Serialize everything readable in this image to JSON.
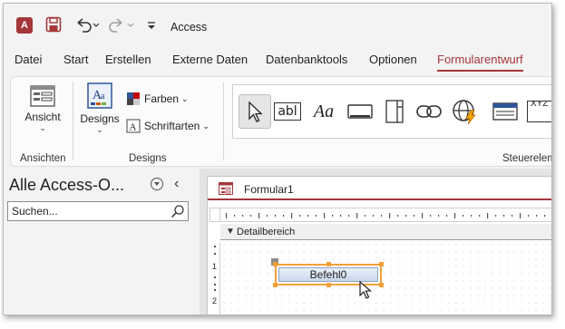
{
  "titlebar": {
    "app_icon_letter": "A",
    "title": "Access",
    "save_icon": "save-icon",
    "undo_icon": "undo-icon",
    "redo_icon": "redo-icon",
    "customize_icon": "customize-qat-icon"
  },
  "tabs": [
    {
      "label": "Datei",
      "active": false
    },
    {
      "label": "Start",
      "active": false
    },
    {
      "label": "Erstellen",
      "active": false
    },
    {
      "label": "Externe Daten",
      "active": false
    },
    {
      "label": "Datenbanktools",
      "active": false
    },
    {
      "label": "Optionen",
      "active": false
    },
    {
      "label": "Formularentwurf",
      "active": true
    }
  ],
  "ribbon": {
    "ansichten": {
      "group_label": "Ansichten",
      "ansicht_label": "Ansicht",
      "ansicht_icon": "form-view-icon"
    },
    "designs": {
      "group_label": "Designs",
      "designs_label": "Designs",
      "designs_icon": "theme-icon",
      "farben_label": "Farben",
      "farben_icon": "colors-icon",
      "schriftarten_label": "Schriftarten",
      "schriftarten_icon": "fonts-icon"
    },
    "steuerelemente": {
      "group_label": "Steuerelemente",
      "tools": [
        {
          "name": "select-tool",
          "icon": "pointer-icon",
          "selected": true
        },
        {
          "name": "textbox-tool",
          "icon": "textbox-icon",
          "text": "abl",
          "selected": false
        },
        {
          "name": "label-tool",
          "icon": "label-icon",
          "text": "Aa",
          "selected": false
        },
        {
          "name": "button-tool",
          "icon": "button-icon",
          "selected": false
        },
        {
          "name": "tab-control-tool",
          "icon": "tab-control-icon",
          "selected": false
        },
        {
          "name": "hyperlink-tool",
          "icon": "link-icon",
          "selected": false
        },
        {
          "name": "web-browser-tool",
          "icon": "web-browser-icon",
          "selected": false
        },
        {
          "name": "navigation-tool",
          "icon": "navigation-control-icon",
          "selected": false
        },
        {
          "name": "option-group-tool",
          "icon": "option-group-icon",
          "text": "XYZ",
          "selected": false
        }
      ]
    }
  },
  "navpane": {
    "title": "Alle Access-O...",
    "dropdown_icon": "chevron-down-circle-icon",
    "collapse_icon": "chevron-left-icon",
    "search_placeholder": "Suchen...",
    "search_icon": "search-icon"
  },
  "document": {
    "tab_icon": "form-icon",
    "tab_title": "Formular1",
    "section_arrow": "▼",
    "section_title": "Detailbereich",
    "ruler_numbers": [
      "1",
      "2"
    ],
    "control": {
      "type": "button",
      "caption": "Befehl0",
      "selected": true
    },
    "accent_color": "#a4373a",
    "selection_color": "#f4a03c"
  }
}
